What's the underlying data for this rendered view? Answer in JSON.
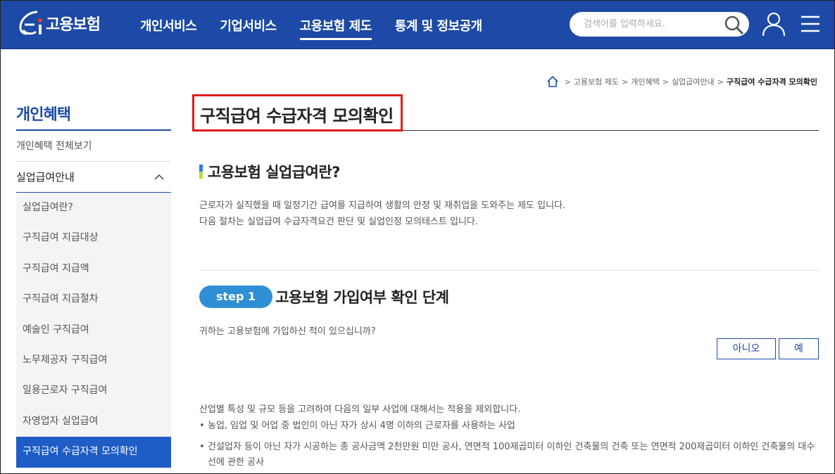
{
  "header": {
    "logo_text": "고용보험",
    "nav": [
      {
        "label": "개인서비스",
        "active": false
      },
      {
        "label": "기업서비스",
        "active": false
      },
      {
        "label": "고용보험 제도",
        "active": true
      },
      {
        "label": "통계 및 정보공개",
        "active": false
      }
    ],
    "search_placeholder": "검색어를 입력하세요.",
    "icons": {
      "search": "search-icon",
      "user": "user-icon",
      "menu": "hamburger-menu-icon"
    },
    "brand_color": "#1c4aa6"
  },
  "breadcrumb": {
    "items": [
      "고용보험 제도",
      "개인혜택",
      "실업급여안내"
    ],
    "current": "구직급여 수급자격 모의확인"
  },
  "sidebar": {
    "title": "개인혜택",
    "all_link": "개인혜택 전체보기",
    "group_label": "실업급여안내",
    "sub_items": [
      {
        "label": "실업급여란?",
        "active": false
      },
      {
        "label": "구직급여 지급대상",
        "active": false
      },
      {
        "label": "구직급여 지급액",
        "active": false
      },
      {
        "label": "구직급여 지급절차",
        "active": false
      },
      {
        "label": "예술인 구직급여",
        "active": false
      },
      {
        "label": "노무제공자 구직급여",
        "active": false
      },
      {
        "label": "일용근로자 구직급여",
        "active": false
      },
      {
        "label": "자영업자 실업급여",
        "active": false
      },
      {
        "label": "구직급여 수급자격 모의확인",
        "active": true
      }
    ]
  },
  "main": {
    "page_title": "구직급여 수급자격 모의확인",
    "section_title": "고용보험 실업급여란?",
    "desc_lines": [
      "근로자가 실직했을 때 일정기간 급여를 지급하여 생활의 안정 및 재취업을 도와주는 제도 입니다.",
      "다음 절차는 실업급여 수급자격요건 판단 및 실업인정 모의테스트 입니다."
    ],
    "step": {
      "badge": "step 1",
      "title": "고용보험 가입여부 확인 단계",
      "question": "귀하는 고용보험에 가입하신 적이 있으십니까?",
      "no_label": "아니오",
      "yes_label": "예"
    },
    "notes": {
      "intro": "산업별 특성 및 규모 등을 고려하여 다음의 일부 사업에 대해서는 적용을 제외합니다.",
      "items": [
        "농업, 임업 및 어업 중 법인이 아닌 자가 상시 4명 이하의 근로자를 사용하는 사업",
        "건설업자 등이 아닌 자가 시공하는 총 공사금액 2천만원 미만 공사, 연면적 100제곱미터 이하인 건축물의 건축 또는 연면적 200제곱미터 이하인 건축물의 대수선에 관한 공사"
      ]
    }
  }
}
